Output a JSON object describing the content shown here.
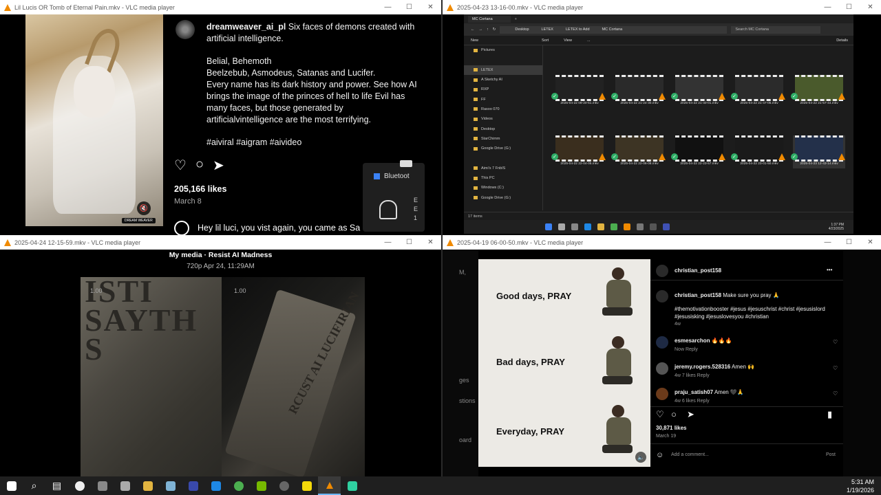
{
  "windows": {
    "w1": {
      "title": "Lil Lucis OR Tomb of Eternal Pain.mkv - VLC media player",
      "post": {
        "username": "dreamweaver_ai_pl",
        "caption_first": "Six faces of demons created with artificial intelligence.",
        "caption_line2": "Belial, Behemoth",
        "caption_line3": "Beelzebub, Asmodeus, Satanas and Lucifer.",
        "caption_line4": "Every name has its dark history and power. See how AI brings the image of the princes of hell to life Evil has many faces, but those generated by artificialvintelligence are the most terrifying.",
        "hashtags": "#aiviral #aigram #aivideo",
        "likes": "205,166 likes",
        "date": "March 8",
        "comment": "Hey lil luci, you vist again, you came as Sa",
        "watermark": "DREAM WEAVER"
      },
      "popup": {
        "bluetooth_label": "Bluetoot",
        "side_text": [
          "E",
          "E",
          "1"
        ]
      }
    },
    "w2": {
      "title": "2025-04-23 13-16-00.mkv - VLC media player",
      "explorer": {
        "tab": "MC Cortana",
        "crumbs": [
          "Desktop",
          "LETEX",
          "LETEX to Add",
          "MC Cortana"
        ],
        "search_placeholder": "Search MC Cortana",
        "cmd": [
          "New",
          "Sort",
          "View",
          "..."
        ],
        "details": "Details",
        "nav": [
          "Pictures",
          "LETEX",
          "A Sketchy AI",
          "RXP",
          "FF",
          "Rasoo 070",
          "Videos",
          "Desktop",
          "StarChimm",
          "Google Drive (G:)",
          "",
          "Aimi's 7 FnbIS",
          "This PC",
          "Windows (C:)",
          "Google Drive (G:)"
        ],
        "thumbs_row1": [
          "2025-04-22 09-20-51.mkv",
          "2025-04-22 21-24-30.mkv",
          "2025-04-22 21-40-01.mkv",
          "2025-04-22 21-47-05.mkv",
          "2025-04-22 21-57-44.mkv"
        ],
        "thumbs_row2": [
          "2025-04-22 22-04-05.mkv",
          "2025-04-22 22-06-08.mkv",
          "2025-04-22 22-23-57.mkv",
          "2025-04-22 23-01-50.mkv",
          "2025-04-23 12-43-14.mkv"
        ],
        "status": "17 items",
        "clock_time": "1:37 PM",
        "clock_date": "4/23/2025"
      }
    },
    "w3": {
      "title": "2025-04-24 12-15-59.mkv - VLC media player",
      "header_title": "My media",
      "header_sep": "·",
      "header_name": "Resist AI Madness",
      "header_sub": "720p   Apr 24, 11:29AM",
      "scale_left": "1.00",
      "scale_right": "1.00",
      "stone_left": "ISTI SAYTH S",
      "stone_right": "RCUST AI LUCIFIRIAN"
    },
    "w4": {
      "title": "2025-04-19 06-00-50.mkv - VLC media player",
      "strip": [
        "M,",
        "ges",
        "stions",
        "oard"
      ],
      "post_lines": [
        "Good days, PRAY",
        "Bad days, PRAY",
        "Everyday, PRAY"
      ],
      "owner": "christian_post158",
      "caption_user": "christian_post158",
      "caption": "Make sure you pray 🙏",
      "hashtags_1": "#themotivationbooster #jesus #jesuschrist #christ #jesusislord",
      "hashtags_2": "#jesusisking #jesuslovesyou #christian",
      "caption_age": "4w",
      "comments": [
        {
          "user": "esmesarchon",
          "text": "🔥🔥🔥",
          "meta": "Now   Reply"
        },
        {
          "user": "jeremy.rogers.528316",
          "text": "Amen 🙌",
          "meta": "4w   7 likes   Reply"
        },
        {
          "user": "praju_satish07",
          "text": "Amen 🖤🙏",
          "meta": "4w   6 likes   Reply"
        }
      ],
      "likes": "30,871 likes",
      "date": "March 19",
      "add_comment_placeholder": "Add a comment...",
      "post_button": "Post",
      "more": "•••"
    }
  },
  "taskbar": {
    "time": "5:31 AM",
    "date": "1/19/2026"
  },
  "icons": {
    "vlc": "vlc-cone-icon",
    "heart": "♡",
    "comment": "○",
    "share": "➤",
    "bookmark": "▮"
  }
}
